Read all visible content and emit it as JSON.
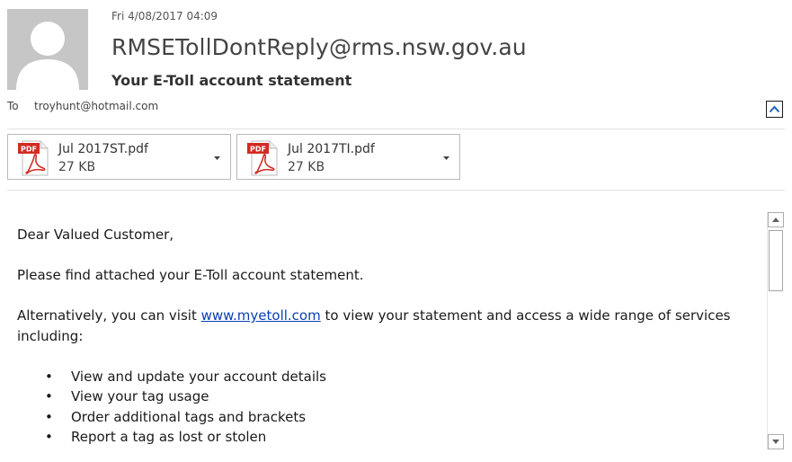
{
  "header": {
    "date": "Fri 4/08/2017 04:09",
    "sender": "RMSETollDontReply@rms.nsw.gov.au",
    "subject": "Your E-Toll account statement",
    "to_label": "To",
    "to_value": "troyhunt@hotmail.com"
  },
  "attachments": [
    {
      "name": "Jul 2017ST.pdf",
      "size": "27 KB",
      "icon_label": "PDF"
    },
    {
      "name": "Jul 2017TI.pdf",
      "size": "27 KB",
      "icon_label": "PDF"
    }
  ],
  "body": {
    "greeting": "Dear Valued Customer,",
    "line1": "Please find attached your E-Toll account statement.",
    "line2_pre": "Alternatively, you can visit ",
    "line2_link": "www.myetoll.com",
    "line2_post": " to view your statement and access a wide range of services including:",
    "bullets": [
      "View and update your account details",
      "View your tag usage",
      "Order additional tags and brackets",
      "Report a tag as lost or stolen"
    ]
  },
  "colors": {
    "pdf_red": "#d22b22",
    "link": "#0b3fb3",
    "avatar_bg": "#c6c6c6"
  },
  "icons": {
    "avatar": "person-silhouette-icon",
    "collapse": "chevron-up-icon",
    "attachment_type": "pdf-icon",
    "attachment_menu": "caret-down-icon",
    "scroll_up": "scroll-up-icon",
    "scroll_down": "scroll-down-icon"
  }
}
